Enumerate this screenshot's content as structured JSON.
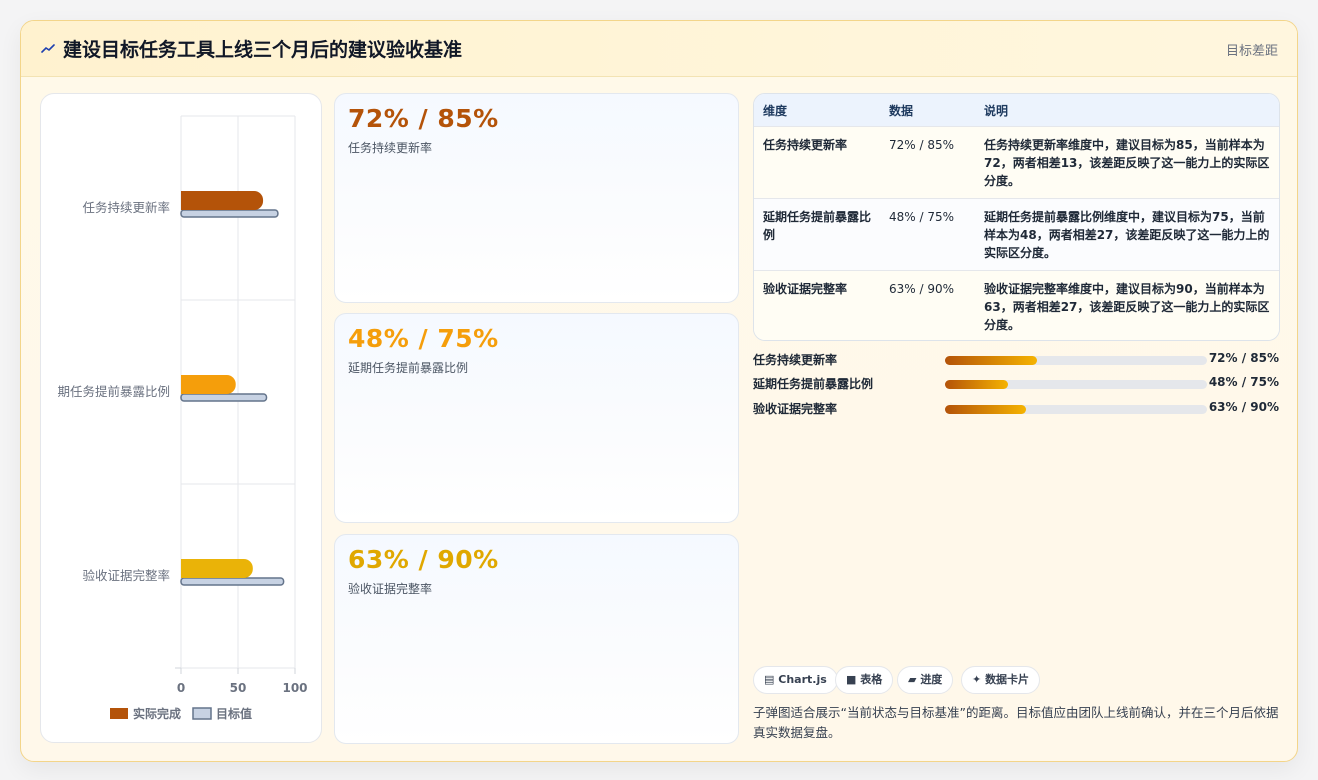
{
  "header": {
    "icon": "line-chart-icon",
    "title": "建设目标任务工具上线三个月后的建议验收基准",
    "tag": "目标差距"
  },
  "chart_data": {
    "type": "bar",
    "orientation": "horizontal",
    "categories": [
      "任务持续更新率",
      "延期任务提前暴露比例",
      "验收证据完整率"
    ],
    "category_labels_as_shown": [
      "任务持续更新率",
      "期任务提前暴露比例",
      "验收证据完整率"
    ],
    "series": [
      {
        "name": "实际完成",
        "values": [
          72,
          48,
          63
        ],
        "colors": [
          "#b45309",
          "#f59e0b",
          "#eab308"
        ]
      },
      {
        "name": "目标值",
        "values": [
          85,
          75,
          90
        ],
        "color": "#c7d2e3"
      }
    ],
    "xlim": [
      0,
      100
    ],
    "xticks": [
      "0",
      "50",
      "100"
    ],
    "grid": true,
    "legend": "bottom"
  },
  "stats": [
    {
      "value": "72% / 85%",
      "label": "任务持续更新率",
      "color": "#b45309"
    },
    {
      "value": "48% / 75%",
      "label": "延期任务提前暴露比例",
      "color": "#f59e0b"
    },
    {
      "value": "63% / 90%",
      "label": "验收证据完整率",
      "color": "#e0a800"
    }
  ],
  "table": {
    "headers": [
      "维度",
      "数据",
      "说明"
    ],
    "rows": [
      {
        "dim": "任务持续更新率",
        "data": "72% / 85%",
        "desc": "任务持续更新率维度中，建议目标为85，当前样本为72，两者相差13，该差距反映了这一能力上的实际区分度。"
      },
      {
        "dim": "延期任务提前暴露比例",
        "data": "48% / 75%",
        "desc": "延期任务提前暴露比例维度中，建议目标为75，当前样本为48，两者相差27，该差距反映了这一能力上的实际区分度。"
      },
      {
        "dim": "验收证据完整率",
        "data": "63% / 90%",
        "desc": "验收证据完整率维度中，建议目标为90，当前样本为63，两者相差27，该差距反映了这一能力上的实际区分度。"
      }
    ]
  },
  "progress": [
    {
      "label": "任务持续更新率",
      "value": "72% / 85%",
      "fraction": 0.35
    },
    {
      "label": "延期任务提前暴露比例",
      "value": "48% / 75%",
      "fraction": 0.24
    },
    {
      "label": "验收证据完整率",
      "value": "63% / 90%",
      "fraction": 0.31
    }
  ],
  "chips": [
    {
      "icon": "chart-icon",
      "glyph": "▤",
      "label": "Chart.js"
    },
    {
      "icon": "table-icon",
      "glyph": "■",
      "label": "表格"
    },
    {
      "icon": "progress-icon",
      "glyph": "▰",
      "label": "进度"
    },
    {
      "icon": "card-icon",
      "glyph": "✦",
      "label": "数据卡片"
    }
  ],
  "note": "子弹图适合展示“当前状态与目标基准”的距离。目标值应由团队上线前确认，并在三个月后依据真实数据复盘。"
}
